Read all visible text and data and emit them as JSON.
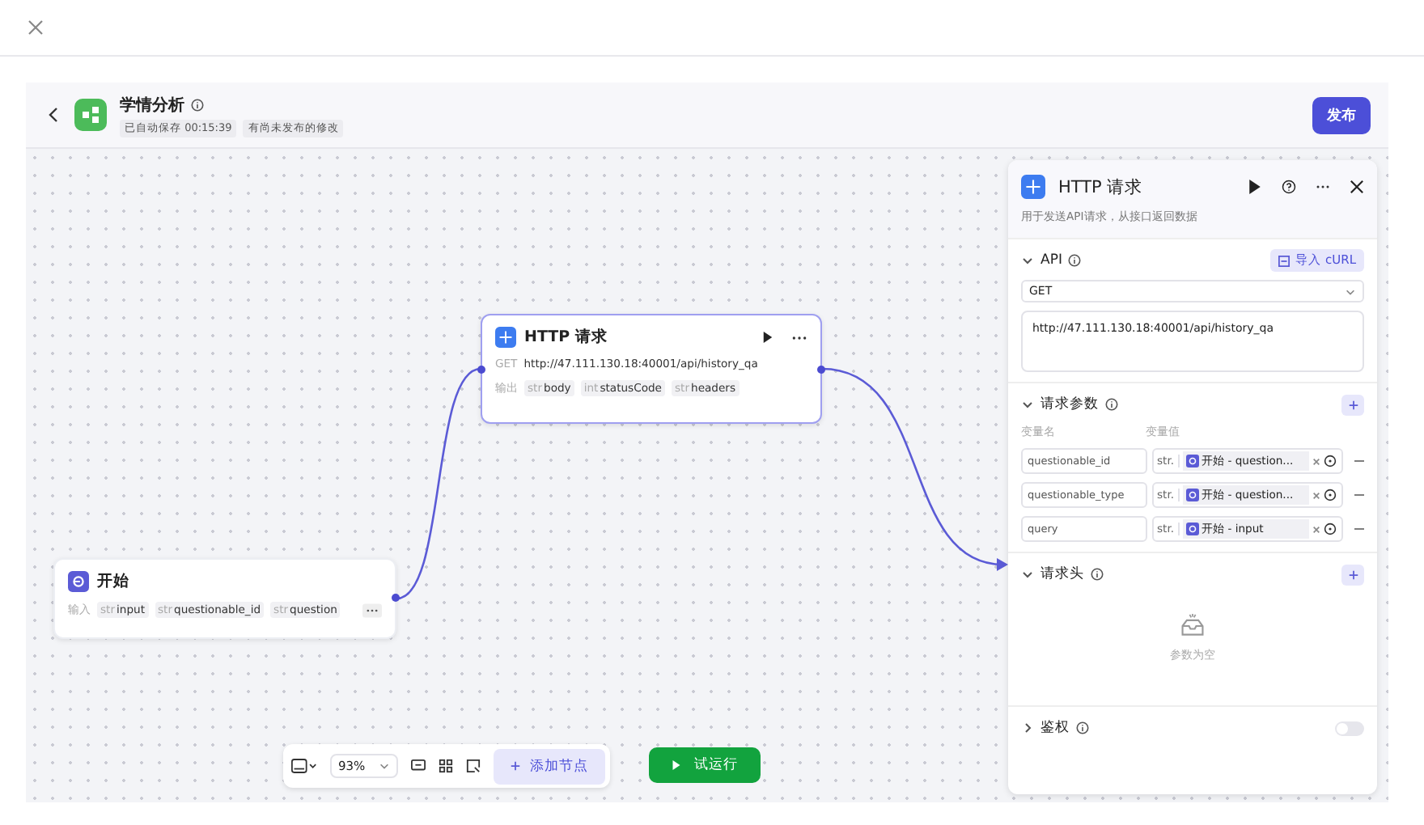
{
  "header": {
    "title": "学情分析",
    "autosave": "已自动保存 00:15:39",
    "unpublished": "有尚未发布的修改",
    "publish_button": "发布"
  },
  "nodes": [
    {
      "kind": "http",
      "title": "HTTP 请求",
      "method": "GET",
      "url": "http://47.111.130.18:40001/api/history_qa",
      "io_label": "输出",
      "vars": [
        {
          "type": "str",
          "name": "body"
        },
        {
          "type": "int",
          "name": "statusCode"
        },
        {
          "type": "str",
          "name": "headers"
        }
      ]
    },
    {
      "kind": "start",
      "title": "开始",
      "io_label": "输入",
      "vars": [
        {
          "type": "str",
          "name": "input"
        },
        {
          "type": "str",
          "name": "questionable_id"
        },
        {
          "type": "str",
          "name": "question"
        }
      ]
    }
  ],
  "inspector": {
    "title": "HTTP 请求",
    "description": "用于发送API请求，从接口返回数据",
    "api": {
      "label": "API",
      "expanded": true,
      "import_button": "导入 cURL",
      "method": "GET",
      "url": "http://47.111.130.18:40001/api/history_qa"
    },
    "params": {
      "label": "请求参数",
      "expanded": true,
      "col_name": "变量名",
      "col_value": "变量值",
      "rows": [
        {
          "name": "questionable_id",
          "type": "str.",
          "ref": "开始 - question..."
        },
        {
          "name": "questionable_type",
          "type": "str.",
          "ref": "开始 - question..."
        },
        {
          "name": "query",
          "type": "str.",
          "ref": "开始 - input"
        }
      ]
    },
    "headers": {
      "label": "请求头",
      "expanded": true,
      "empty": "参数为空"
    },
    "auth": {
      "label": "鉴权",
      "expanded": false,
      "on": false
    }
  },
  "toolbar": {
    "zoom": "93%",
    "add_node": "添加节点",
    "run": "试运行"
  }
}
